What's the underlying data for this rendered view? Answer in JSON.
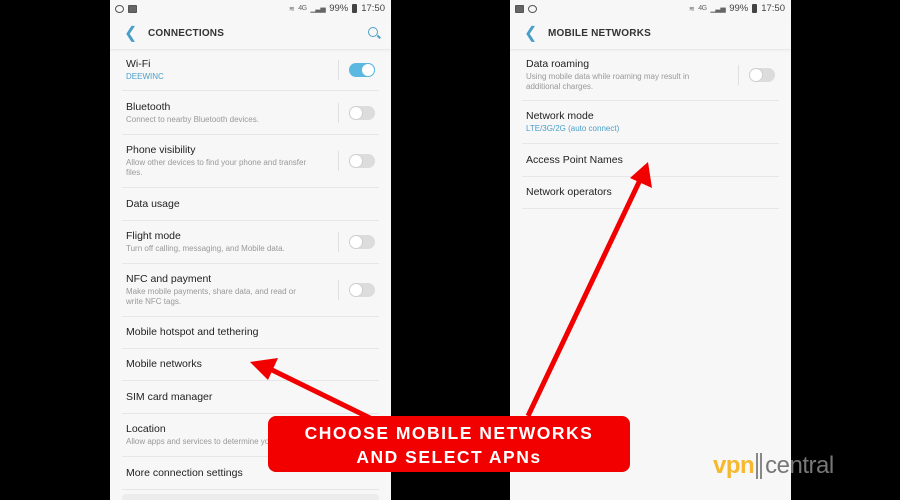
{
  "status_bar": {
    "battery": "99%",
    "time": "17:50",
    "network": "4G"
  },
  "left_screen": {
    "title": "CONNECTIONS",
    "items": [
      {
        "label": "Wi-Fi",
        "sub": "DEEWINC",
        "sub_accent": true,
        "toggle": true,
        "toggle_on": true
      },
      {
        "label": "Bluetooth",
        "sub": "Connect to nearby Bluetooth devices.",
        "toggle": true,
        "toggle_on": false
      },
      {
        "label": "Phone visibility",
        "sub": "Allow other devices to find your phone and transfer files.",
        "toggle": true,
        "toggle_on": false
      },
      {
        "label": "Data usage"
      },
      {
        "label": "Flight mode",
        "sub": "Turn off calling, messaging, and Mobile data.",
        "toggle": true,
        "toggle_on": false
      },
      {
        "label": "NFC and payment",
        "sub": "Make mobile payments, share data, and read or write NFC tags.",
        "toggle": true,
        "toggle_on": false
      },
      {
        "label": "Mobile hotspot and tethering"
      },
      {
        "label": "Mobile networks"
      },
      {
        "label": "SIM card manager"
      },
      {
        "label": "Location",
        "sub": "Allow apps and services to determine your location."
      },
      {
        "label": "More connection settings"
      }
    ]
  },
  "right_screen": {
    "title": "MOBILE NETWORKS",
    "items": [
      {
        "label": "Data roaming",
        "sub": "Using mobile data while roaming may result in additional charges.",
        "toggle": true,
        "toggle_on": false
      },
      {
        "label": "Network mode",
        "sub": "LTE/3G/2G (auto connect)",
        "sub_accent": true
      },
      {
        "label": "Access Point Names"
      },
      {
        "label": "Network operators"
      }
    ]
  },
  "annotation": {
    "line1": "CHOOSE MOBILE NETWORKS",
    "line2": "AND SELECT APNs",
    "color": "#f20000"
  },
  "watermark": {
    "part1": "vpn",
    "part2": "central"
  }
}
